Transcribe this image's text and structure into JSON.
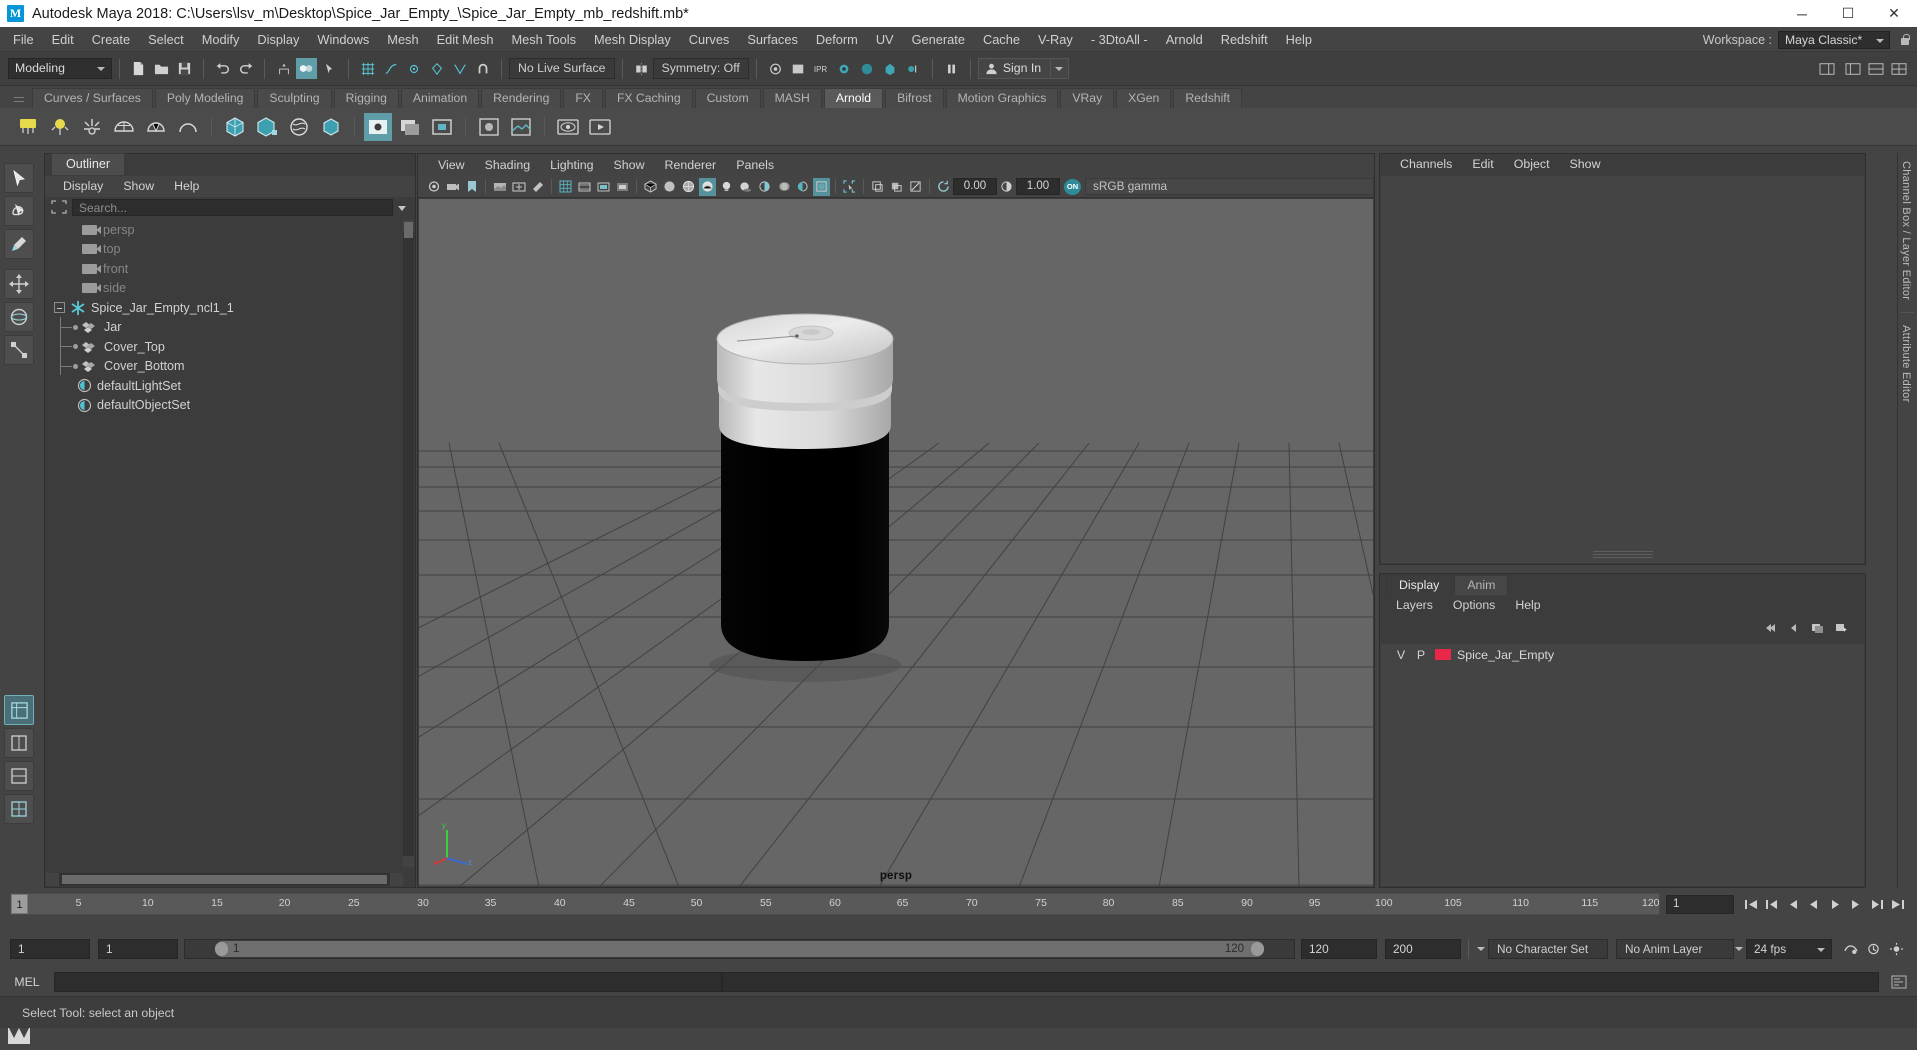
{
  "titlebar": {
    "logo": "M",
    "title": "Autodesk Maya 2018: C:\\Users\\lsv_m\\Desktop\\Spice_Jar_Empty_\\Spice_Jar_Empty_mb_redshift.mb*",
    "minimize": "─",
    "maximize": "☐",
    "close": "✕"
  },
  "menubar": {
    "items": [
      "File",
      "Edit",
      "Create",
      "Select",
      "Modify",
      "Display",
      "Windows",
      "Mesh",
      "Edit Mesh",
      "Mesh Tools",
      "Mesh Display",
      "Curves",
      "Surfaces",
      "Deform",
      "UV",
      "Generate",
      "Cache",
      "V-Ray",
      "- 3DtoAll -",
      "Arnold",
      "Redshift",
      "Help"
    ],
    "workspace_label": "Workspace :",
    "workspace_value": "Maya Classic*"
  },
  "statusbar": {
    "mode": "Modeling",
    "no_live_surface": "No Live Surface",
    "symmetry": "Symmetry: Off",
    "signin": "Sign In"
  },
  "shelf": {
    "tabs": [
      {
        "label": "Curves / Surfaces",
        "active": false
      },
      {
        "label": "Poly Modeling",
        "active": false
      },
      {
        "label": "Sculpting",
        "active": false
      },
      {
        "label": "Rigging",
        "active": false
      },
      {
        "label": "Animation",
        "active": false
      },
      {
        "label": "Rendering",
        "active": false
      },
      {
        "label": "FX",
        "active": false
      },
      {
        "label": "FX Caching",
        "active": false
      },
      {
        "label": "Custom",
        "active": false
      },
      {
        "label": "MASH",
        "active": false
      },
      {
        "label": "Arnold",
        "active": true
      },
      {
        "label": "Bifrost",
        "active": false
      },
      {
        "label": "Motion Graphics",
        "active": false
      },
      {
        "label": "VRay",
        "active": false
      },
      {
        "label": "XGen",
        "active": false
      },
      {
        "label": "Redshift",
        "active": false
      }
    ]
  },
  "outliner": {
    "tab": "Outliner",
    "menu": [
      "Display",
      "Show",
      "Help"
    ],
    "search_placeholder": "Search...",
    "tree": [
      {
        "label": "persp",
        "icon": "camera-icon",
        "type": "camera",
        "depth": 1,
        "dim": true
      },
      {
        "label": "top",
        "icon": "camera-icon",
        "type": "camera",
        "depth": 1,
        "dim": true
      },
      {
        "label": "front",
        "icon": "camera-icon",
        "type": "camera",
        "depth": 1,
        "dim": true
      },
      {
        "label": "side",
        "icon": "camera-icon",
        "type": "camera",
        "depth": 1,
        "dim": true
      },
      {
        "label": "Spice_Jar_Empty_ncl1_1",
        "icon": "group-star-icon",
        "type": "group",
        "depth": 0,
        "dim": false
      },
      {
        "label": "Jar",
        "icon": "mesh-icon",
        "type": "mesh",
        "depth": 1,
        "dim": false
      },
      {
        "label": "Cover_Top",
        "icon": "mesh-icon",
        "type": "mesh",
        "depth": 1,
        "dim": false
      },
      {
        "label": "Cover_Bottom",
        "icon": "mesh-icon",
        "type": "mesh",
        "depth": 1,
        "dim": false
      },
      {
        "label": "defaultLightSet",
        "icon": "set-icon",
        "type": "set",
        "depth": 1,
        "dim": false
      },
      {
        "label": "defaultObjectSet",
        "icon": "set-icon",
        "type": "set",
        "depth": 1,
        "dim": false
      }
    ]
  },
  "viewport": {
    "menu": [
      "View",
      "Shading",
      "Lighting",
      "Show",
      "Renderer",
      "Panels"
    ],
    "exposure": "0.00",
    "gamma": "1.00",
    "color_management_toggle": "ON",
    "color_profile": "sRGB gamma",
    "camera_label": "persp",
    "axis": {
      "x": "x",
      "y": "y",
      "z": "z"
    }
  },
  "channelbox": {
    "tabs": [
      "Channels",
      "Edit",
      "Object",
      "Show"
    ]
  },
  "layereditor": {
    "tabs": [
      {
        "label": "Display",
        "active": true
      },
      {
        "label": "Anim",
        "active": false
      }
    ],
    "menu": [
      "Layers",
      "Options",
      "Help"
    ],
    "columns": {
      "visibility": "V",
      "playback": "P"
    },
    "layers": [
      {
        "v": "V",
        "p": "P",
        "color": "#e8274b",
        "name": "Spice_Jar_Empty"
      }
    ]
  },
  "right_tabs": [
    "Channel Box / Layer Editor",
    "Attribute Editor"
  ],
  "timeline": {
    "current_frame": "1",
    "ticks": [
      "5",
      "10",
      "15",
      "20",
      "25",
      "30",
      "35",
      "40",
      "45",
      "50",
      "55",
      "60",
      "65",
      "70",
      "75",
      "80",
      "85",
      "90",
      "95",
      "100",
      "105",
      "110",
      "115",
      "120"
    ],
    "end_field": "1",
    "transport": [
      "go-to-start",
      "step-back-key",
      "step-back",
      "play-backwards",
      "play-forwards",
      "step-forward",
      "step-forward-key",
      "go-to-end"
    ]
  },
  "rangeslider": {
    "anim_start": "1",
    "range_start": "1",
    "slider_left": "1",
    "slider_right": "120",
    "range_end": "120",
    "anim_end": "200",
    "character_set": "No Character Set",
    "anim_layer": "No Anim Layer",
    "fps": "24 fps"
  },
  "mel": {
    "label": "MEL",
    "input_value": "",
    "output_value": ""
  },
  "helpline": {
    "text": "Select Tool: select an object"
  },
  "colors": {
    "accent_teal": "#5f9ea8",
    "panel_bg": "#444444",
    "viewport_bg": "#666666",
    "layer_swatch": "#e8274b",
    "title_bg": "#ffffff"
  }
}
